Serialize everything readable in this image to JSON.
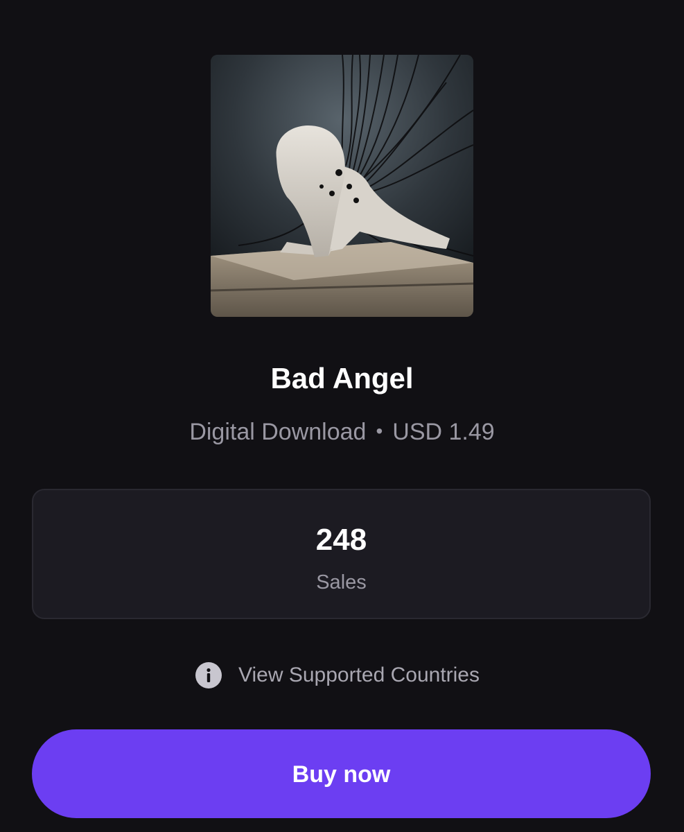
{
  "product": {
    "title": "Bad Angel",
    "format": "Digital Download",
    "separator": "•",
    "price": "USD 1.49"
  },
  "stats": {
    "value": "248",
    "label": "Sales"
  },
  "countries": {
    "label": "View Supported Countries",
    "icon": "info-icon"
  },
  "buy": {
    "label": "Buy now"
  },
  "colors": {
    "background": "#111014",
    "card": "#1c1b22",
    "accent": "#6c3ef2",
    "muted_text": "#9a98a3"
  }
}
